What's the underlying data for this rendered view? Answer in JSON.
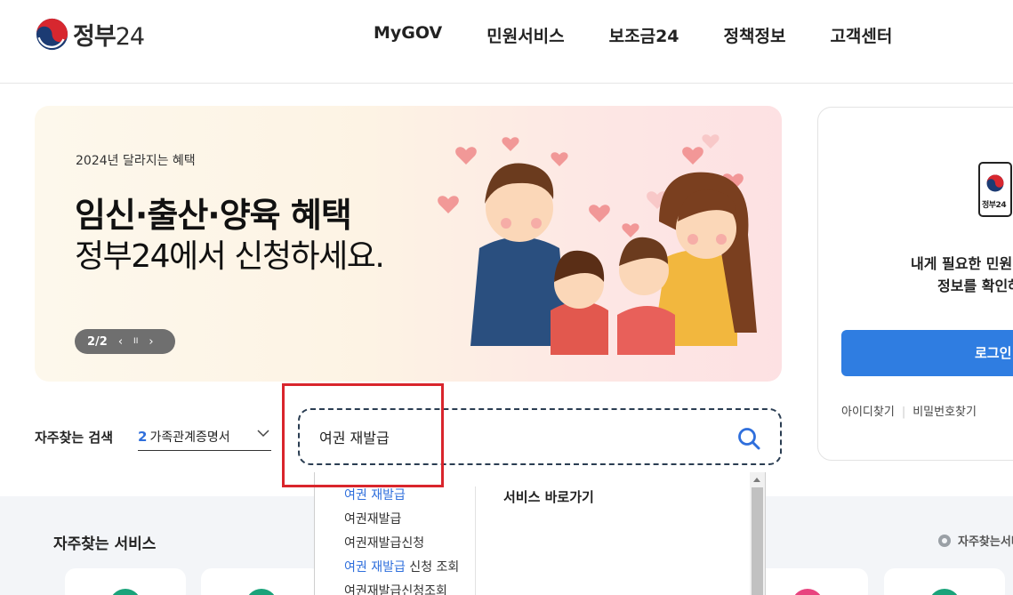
{
  "header": {
    "logo_text": "정부",
    "logo_num": "24",
    "nav": [
      "MyGOV",
      "민원서비스",
      "보조금24",
      "정책정보",
      "고객센터"
    ]
  },
  "banner": {
    "subtitle": "2024년 달라지는 혜택",
    "title": "임신·출산·양육 혜택",
    "title2": "정부24에서 신청하세요.",
    "pager": {
      "count": "2/2",
      "prev": "‹",
      "pause": "II",
      "next": "›"
    }
  },
  "login": {
    "phone_label": "정부24",
    "message_line1": "내게 필요한 민원",
    "message_line2": "정보를 확인하",
    "button": "로그인",
    "find_id": "아이디찾기",
    "find_password": "비밀번호찾기"
  },
  "search": {
    "frequent_label": "자주찾는 검색",
    "frequent_rank": "2",
    "frequent_term": "가족관계증명서",
    "query": "여권 재발급"
  },
  "autocomplete": {
    "items": [
      {
        "highlight": "여권 재발급",
        "rest": ""
      },
      {
        "highlight": "",
        "rest": "여권재발급"
      },
      {
        "highlight": "",
        "rest": "여권재발급신청"
      },
      {
        "highlight": "여권 재발급",
        "rest": " 신청 조회"
      },
      {
        "highlight": "",
        "rest": "여권재발급신청조회"
      }
    ],
    "shortcut_heading": "서비스 바로가기"
  },
  "services": {
    "title": "자주찾는 서비스",
    "settings": "자주찾는서비",
    "card_colors": [
      "#1aa37a",
      "#1aa37a",
      "#e8447f",
      "#1aa37a"
    ]
  },
  "colors": {
    "accent_blue": "#2f7de1",
    "highlight_blue": "#2f6fdc",
    "annotation_red": "#d9252c"
  }
}
